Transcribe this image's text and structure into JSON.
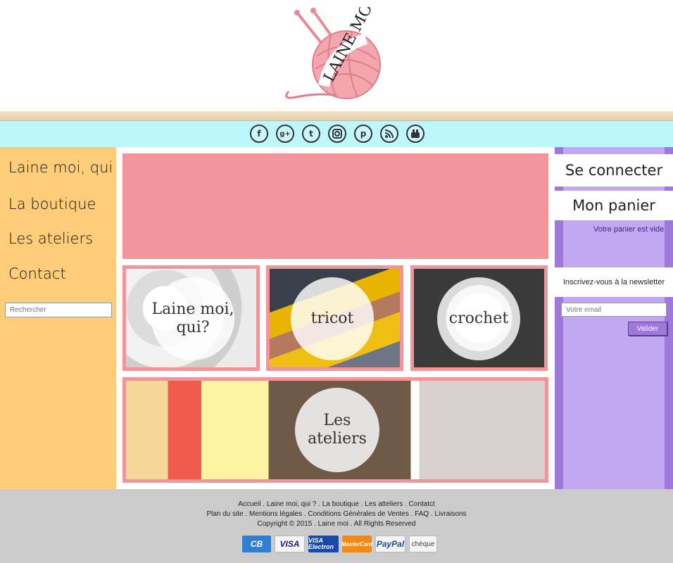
{
  "brand": {
    "logo_text": "LAINE MOI"
  },
  "social": [
    "facebook-icon",
    "google-plus-icon",
    "tumblr-icon",
    "instagram-icon",
    "pinterest-icon",
    "rss-icon",
    "youtube-icon"
  ],
  "nav": {
    "items": [
      {
        "label": "Laine moi, qui"
      },
      {
        "label": "La boutique"
      },
      {
        "label": "Les ateliers"
      },
      {
        "label": "Contact"
      }
    ],
    "search_placeholder": "Rechercher"
  },
  "tiles": {
    "laine": "Laine moi, qui?",
    "tricot": "tricot",
    "crochet": "crochet",
    "ateliers": "Les ateliers"
  },
  "right": {
    "connect": "Se connecter",
    "cart": "Mon panier",
    "cart_empty": "Votre panier est vide",
    "newsletter": "Inscrivez-vous à la newsletter",
    "email_placeholder": "Votre email",
    "validate": "Valider"
  },
  "footer": {
    "line1": "Accueil . Laine moi, qui ? . La boutique . Les atteliers . Contatct",
    "line2": "Plan du site . Mentions légales . Conditions Générales de Ventes . FAQ . Livraisons",
    "line3": "Copyright © 2015 . Laine moi . All Rights Reserved",
    "payments": [
      "CB",
      "VISA",
      "VISA Electron",
      "MasterCard",
      "PayPal",
      "chèque"
    ]
  },
  "colors": {
    "social_bar": "#bdf6fb",
    "left_sidebar": "#fecd7a",
    "banner": "#f2959a",
    "right_sidebar": "#9f78dc",
    "right_inner": "#c2a8f0",
    "footer": "#cbcbcb"
  }
}
